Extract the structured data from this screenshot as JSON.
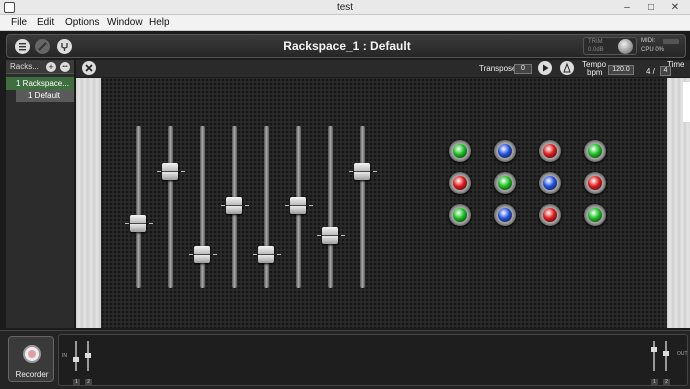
{
  "window": {
    "title": "test",
    "minimize": "–",
    "maximize": "□",
    "close": "✕"
  },
  "menu": [
    "File",
    "Edit",
    "Options",
    "Window",
    "Help"
  ],
  "header": {
    "rackspace_title": "Rackspace_1 : Default",
    "trim_label": "TRIM",
    "trim_value": "0.0dB",
    "midi_label": "MIDI:",
    "cpu_label": "CPU  0%"
  },
  "rack_panel": {
    "title": "Racks...",
    "add": "+",
    "more": "•••",
    "rackspace_item": "1  Rackspace...",
    "variation_item": "1  Default"
  },
  "toolbar": {
    "transpose_label": "Transpose",
    "transpose_value": "0",
    "tempo_label": "Tempo",
    "tempo_unit": "bpm",
    "tempo_value": "120.0",
    "time_label": "Time",
    "time_numerator": "4 /",
    "time_denominator": "4"
  },
  "faders": [
    {
      "level": 0.4
    },
    {
      "level": 0.72
    },
    {
      "level": 0.21
    },
    {
      "level": 0.51
    },
    {
      "level": 0.21
    },
    {
      "level": 0.51
    },
    {
      "level": 0.33
    },
    {
      "level": 0.72
    }
  ],
  "leds": [
    [
      "#18c020",
      "#2050e0",
      "#e01818",
      "#18c020"
    ],
    [
      "#e01818",
      "#18c020",
      "#2050e0",
      "#e01818"
    ],
    [
      "#18c020",
      "#2050e0",
      "#e01818",
      "#18c020"
    ]
  ],
  "recorder": {
    "label": "Recorder"
  },
  "mixer": {
    "in_label": "IN",
    "out_label": "OUT",
    "ch1": "1",
    "ch2": "2"
  }
}
